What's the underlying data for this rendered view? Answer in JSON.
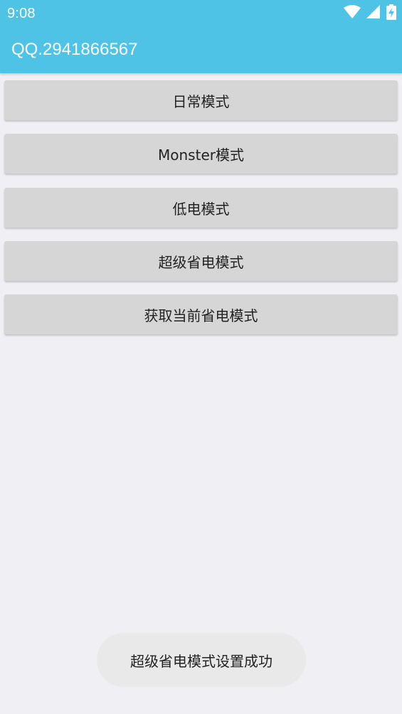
{
  "status_bar": {
    "time": "9:08",
    "icons": [
      "wifi-icon",
      "signal-icon",
      "battery-charging-icon"
    ]
  },
  "app_bar": {
    "title": "QQ.2941866567"
  },
  "buttons": [
    {
      "label": "日常模式"
    },
    {
      "label": "Monster模式"
    },
    {
      "label": "低电模式"
    },
    {
      "label": "超级省电模式"
    },
    {
      "label": "获取当前省电模式"
    }
  ],
  "toast": {
    "message": "超级省电模式设置成功"
  },
  "colors": {
    "accent": "#4fc3e6",
    "background": "#efeff4",
    "button": "#d6d6d6"
  }
}
